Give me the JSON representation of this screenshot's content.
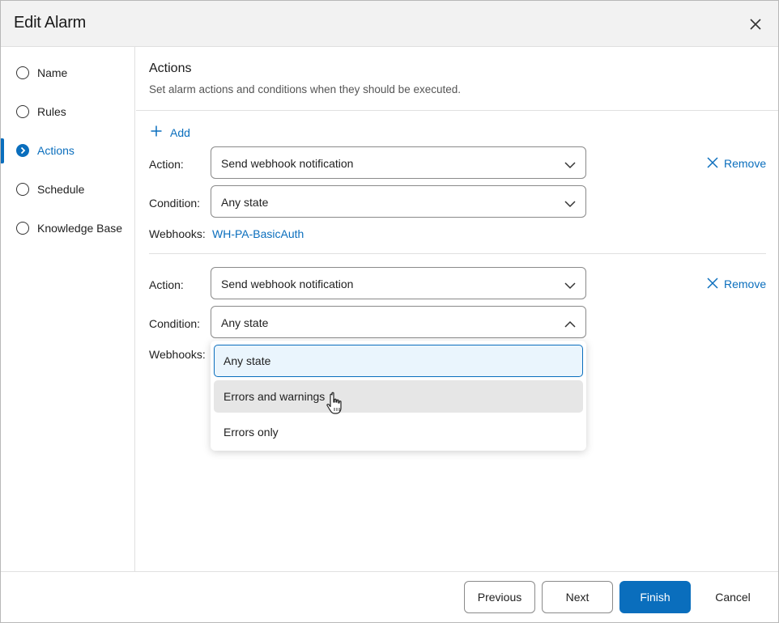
{
  "dialog": {
    "title": "Edit Alarm",
    "close_icon": "close-icon"
  },
  "sidebar": {
    "items": [
      {
        "label": "Name",
        "state": "unvisited"
      },
      {
        "label": "Rules",
        "state": "unvisited"
      },
      {
        "label": "Actions",
        "state": "active"
      },
      {
        "label": "Schedule",
        "state": "unvisited"
      },
      {
        "label": "Knowledge Base",
        "state": "unvisited"
      }
    ]
  },
  "section": {
    "title": "Actions",
    "description": "Set alarm actions and conditions when they should be executed."
  },
  "add_label": "Add",
  "labels": {
    "action": "Action:",
    "condition": "Condition:",
    "webhooks": "Webhooks:",
    "remove": "Remove"
  },
  "actions": [
    {
      "action": "Send webhook notification",
      "condition": "Any state",
      "webhook": "WH-PA-BasicAuth"
    },
    {
      "action": "Send webhook notification",
      "condition": "Any state",
      "webhook": ""
    }
  ],
  "condition_dropdown": {
    "open": true,
    "options": [
      "Any state",
      "Errors and warnings",
      "Errors only"
    ],
    "selected": "Any state",
    "hovered": "Errors and warnings"
  },
  "footer": {
    "previous": "Previous",
    "next": "Next",
    "finish": "Finish",
    "cancel": "Cancel"
  },
  "colors": {
    "accent": "#0a6ebd",
    "header_bg": "#f2f2f2",
    "hover_bg": "#e6e6e6",
    "selected_bg": "#eaf5fd"
  }
}
